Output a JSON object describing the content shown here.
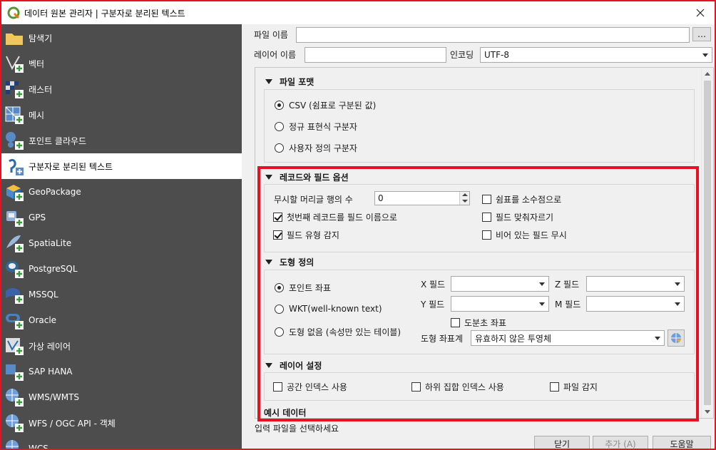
{
  "window": {
    "title": "데이터 원본 관리자 | 구분자로 분리된 텍스트",
    "accent_color": "#e81123"
  },
  "sidebar": {
    "items": [
      {
        "label": "탐색기",
        "icon": "folder-icon"
      },
      {
        "label": "벡터",
        "icon": "vector-icon"
      },
      {
        "label": "래스터",
        "icon": "raster-icon"
      },
      {
        "label": "메시",
        "icon": "mesh-icon"
      },
      {
        "label": "포인트 클라우드",
        "icon": "point-cloud-icon"
      },
      {
        "label": "구분자로 분리된 텍스트",
        "icon": "delimited-text-icon",
        "active": true
      },
      {
        "label": "GeoPackage",
        "icon": "geopackage-icon"
      },
      {
        "label": "GPS",
        "icon": "gps-icon"
      },
      {
        "label": "SpatiaLite",
        "icon": "spatialite-icon"
      },
      {
        "label": "PostgreSQL",
        "icon": "postgresql-icon"
      },
      {
        "label": "MSSQL",
        "icon": "mssql-icon"
      },
      {
        "label": "Oracle",
        "icon": "oracle-icon"
      },
      {
        "label": "가상 레이어",
        "icon": "virtual-layer-icon"
      },
      {
        "label": "SAP HANA",
        "icon": "sap-hana-icon"
      },
      {
        "label": "WMS/WMTS",
        "icon": "wms-icon"
      },
      {
        "label": "WFS / OGC API - 객체",
        "icon": "wfs-icon"
      },
      {
        "label": "WCS",
        "icon": "wcs-icon"
      }
    ]
  },
  "top": {
    "file_name_label": "파일 이름",
    "file_name_value": "",
    "browse_label": "…",
    "layer_name_label": "레이어 이름",
    "layer_name_value": "",
    "encoding_label": "인코딩",
    "encoding_value": "UTF-8"
  },
  "file_format": {
    "header": "파일 포맷",
    "options": [
      {
        "label": "CSV (쉼표로 구분된 값)",
        "selected": true
      },
      {
        "label": "정규 표현식 구분자",
        "selected": false
      },
      {
        "label": "사용자 정의 구분자",
        "selected": false
      }
    ]
  },
  "records": {
    "header": "레코드와 필드 옵션",
    "skip_lines_label": "무시할 머리글 행의 수",
    "skip_lines_value": "0",
    "first_record_label": "첫번째 레코드를 필드 이름으로",
    "first_record_checked": true,
    "detect_types_label": "필드 유형 감지",
    "detect_types_checked": true,
    "decimal_comma_label": "쉼표를 소수점으로",
    "decimal_comma_checked": false,
    "trim_fields_label": "필드 맞춰자르기",
    "trim_fields_checked": false,
    "discard_empty_label": "비어 있는 필드 무시",
    "discard_empty_checked": false
  },
  "geometry": {
    "header": "도형 정의",
    "point_label": "포인트 좌표",
    "point_selected": true,
    "wkt_label": "WKT(well-known text)",
    "wkt_selected": false,
    "none_label": "도형 없음 (속성만 있는 테이블)",
    "none_selected": false,
    "x_field_label": "X 필드",
    "x_field_value": "",
    "y_field_label": "Y 필드",
    "y_field_value": "",
    "z_field_label": "Z 필드",
    "z_field_value": "",
    "m_field_label": "M 필드",
    "m_field_value": "",
    "dms_label": "도분초 좌표",
    "dms_checked": false,
    "crs_label": "도형 좌표계",
    "crs_value": "유효하지 않은 투영체"
  },
  "layer_settings": {
    "header": "레이어 설정",
    "spatial_index_label": "공간 인덱스 사용",
    "subset_index_label": "하위 집합 인덱스 사용",
    "watch_file_label": "파일 감지"
  },
  "sample": {
    "header": "예시 데이터"
  },
  "status_text": "입력 파일을 선택하세요",
  "buttons": {
    "close": "닫기",
    "add": "추가 (A)",
    "help": "도움말"
  }
}
